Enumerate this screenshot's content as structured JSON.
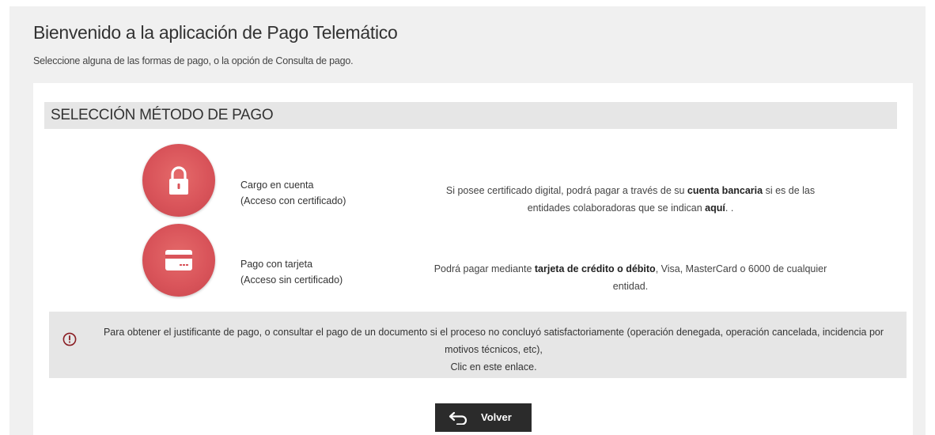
{
  "page": {
    "title": "Bienvenido a la aplicación de Pago Telemático",
    "subtitle": "Seleccione alguna de las formas de pago, o la opción de Consulta de pago."
  },
  "section": {
    "header": "SELECCIÓN MÉTODO DE PAGO"
  },
  "methods": [
    {
      "icon": "lock-icon",
      "label_line1": "Cargo en cuenta",
      "label_line2": "(Acceso con certificado)",
      "desc_part1": "Si posee certificado digital, podrá pagar a través de su ",
      "desc_bold": "cuenta bancaria",
      "desc_part2": " si es de las entidades colaboradoras que se indican ",
      "desc_link": "aquí",
      "desc_part3": ". ."
    },
    {
      "icon": "credit-card-icon",
      "label_line1": "Pago con tarjeta",
      "label_line2": "(Acceso sin certificado)",
      "desc_part1": "Podrá pagar mediante ",
      "desc_bold": "tarjeta de crédito o débito",
      "desc_part2": ", Visa, MasterCard o 6000 de cualquier entidad."
    }
  ],
  "notice": {
    "icon": "exclamation-circle-icon",
    "text": "Para obtener el justificante de pago, o consultar el pago de un documento si el proceso no concluyó satisfactoriamente (operación denegada, operación cancelada, incidencia por motivos técnicos, etc),",
    "link": "Clic en este enlace."
  },
  "back_button": {
    "icon": "back-arrow-icon",
    "label": "Volver"
  },
  "colors": {
    "icon_red": "#d9545a",
    "button_dark": "#2b2b2b",
    "panel_grey": "#e6e6e6",
    "frame_grey": "#f0f0f0"
  }
}
